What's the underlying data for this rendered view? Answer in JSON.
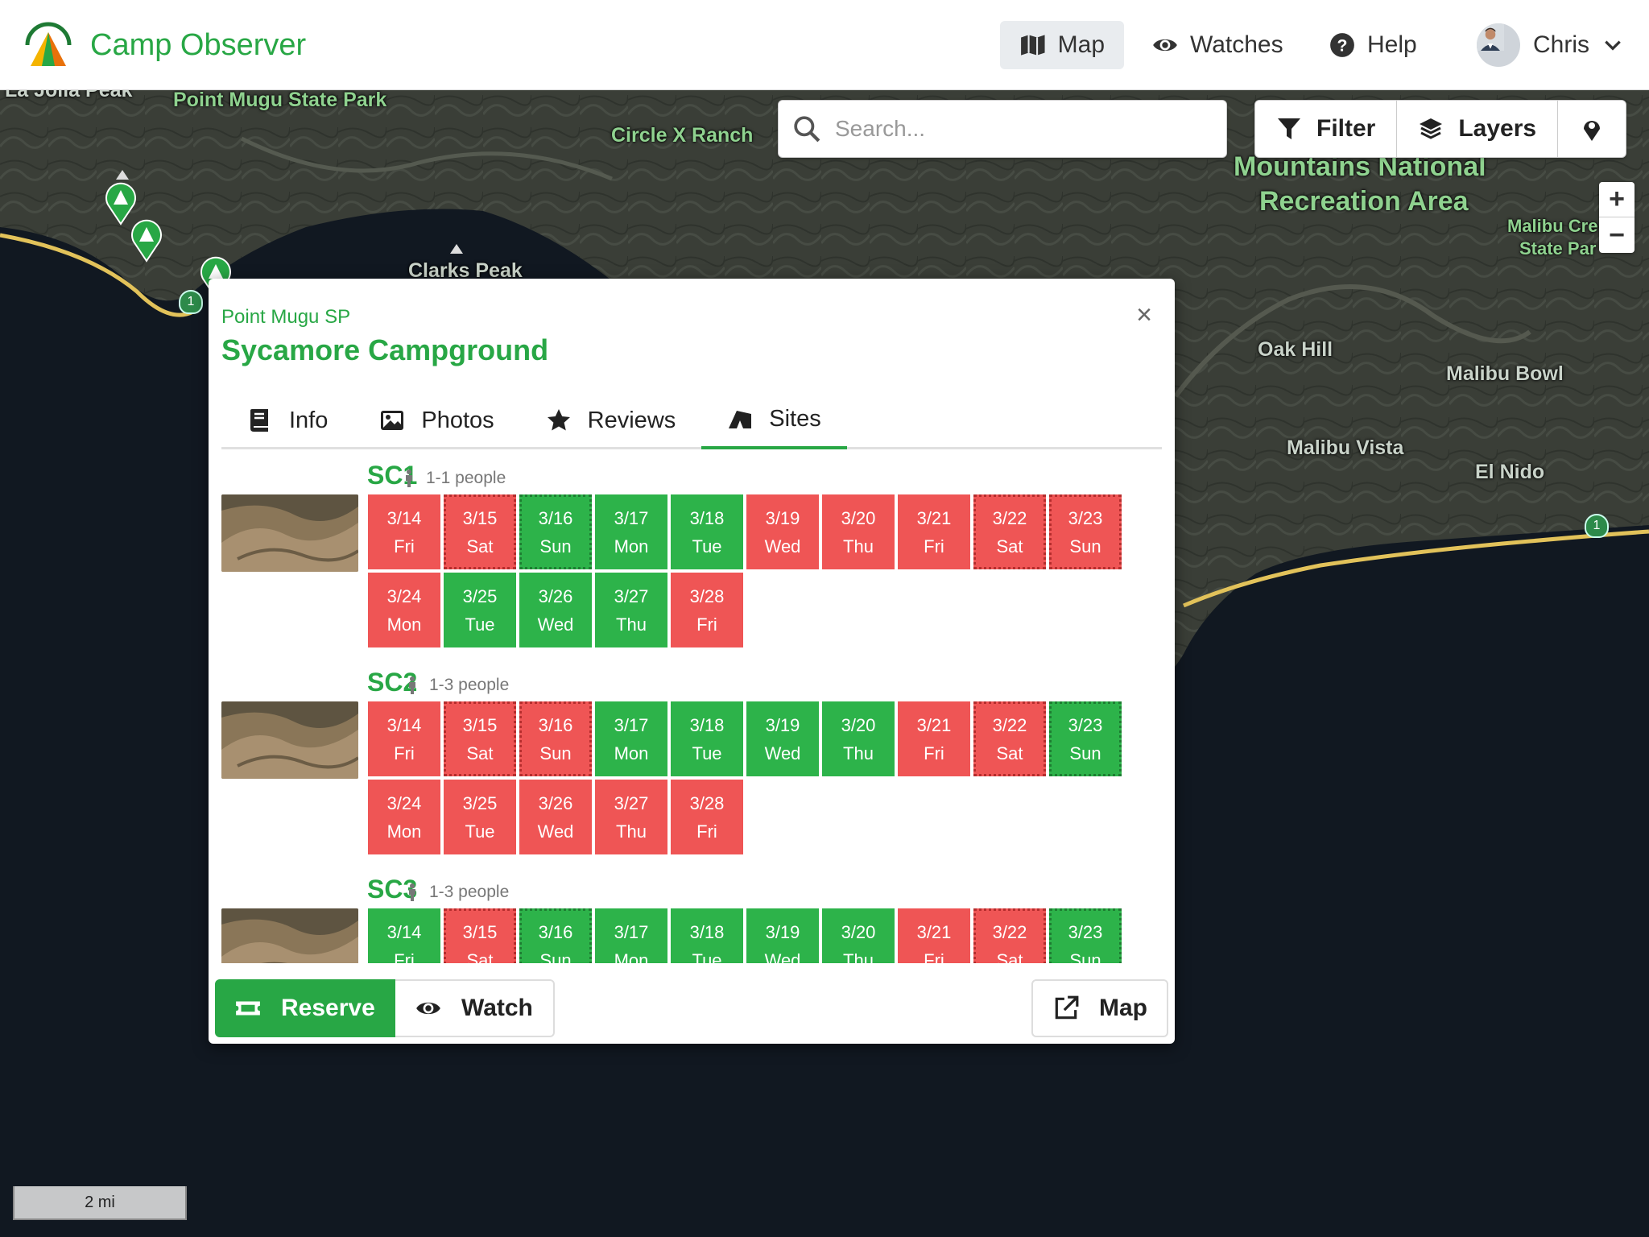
{
  "navbar": {
    "brand": "Camp Observer",
    "items": [
      {
        "label": "Map",
        "icon": "map-icon",
        "active": true
      },
      {
        "label": "Watches",
        "icon": "eye-icon"
      },
      {
        "label": "Help",
        "icon": "question-circle-icon"
      }
    ],
    "user": {
      "name": "Chris"
    }
  },
  "map": {
    "search_placeholder": "Search...",
    "tools": [
      {
        "label": "Filter",
        "icon": "filter-icon"
      },
      {
        "label": "Layers",
        "icon": "layers-icon"
      },
      {
        "label": "",
        "icon": "location-pin-icon"
      }
    ],
    "zoom_in": "+",
    "zoom_out": "−",
    "scale": "2 mi",
    "labels": {
      "la_jolla": "La Jolla Peak",
      "point_mugu": "Point Mugu State Park",
      "circle_x": "Circle X Ranch",
      "smnra_1": "Mountains National",
      "smnra_2": "Recreation Area",
      "malibu_creek_1": "Malibu Cre",
      "malibu_creek_2": "State Par",
      "clarks_peak": "Clarks Peak",
      "oak_hill": "Oak Hill",
      "malibu_bowl": "Malibu Bowl",
      "malibu_vista": "Malibu Vista",
      "el_nido": "El Nido",
      "route": "1"
    }
  },
  "popup": {
    "park": "Point Mugu SP",
    "title": "Sycamore Campground",
    "close": "×",
    "tabs": [
      {
        "label": "Info",
        "icon": "book-icon"
      },
      {
        "label": "Photos",
        "icon": "image-icon"
      },
      {
        "label": "Reviews",
        "icon": "star-icon"
      },
      {
        "label": "Sites",
        "icon": "campground-icon",
        "active": true
      }
    ],
    "sites": [
      {
        "name": "SC1",
        "people": "1-1 people",
        "days": [
          {
            "date": "3/14",
            "dow": "Fri",
            "status": "closed",
            "weekend": false
          },
          {
            "date": "3/15",
            "dow": "Sat",
            "status": "closed",
            "weekend": true
          },
          {
            "date": "3/16",
            "dow": "Sun",
            "status": "open",
            "weekend": true
          },
          {
            "date": "3/17",
            "dow": "Mon",
            "status": "open",
            "weekend": false
          },
          {
            "date": "3/18",
            "dow": "Tue",
            "status": "open",
            "weekend": false
          },
          {
            "date": "3/19",
            "dow": "Wed",
            "status": "closed",
            "weekend": false
          },
          {
            "date": "3/20",
            "dow": "Thu",
            "status": "closed",
            "weekend": false
          },
          {
            "date": "3/21",
            "dow": "Fri",
            "status": "closed",
            "weekend": false
          },
          {
            "date": "3/22",
            "dow": "Sat",
            "status": "closed",
            "weekend": true
          },
          {
            "date": "3/23",
            "dow": "Sun",
            "status": "closed",
            "weekend": true
          },
          {
            "date": "3/24",
            "dow": "Mon",
            "status": "closed",
            "weekend": false
          },
          {
            "date": "3/25",
            "dow": "Tue",
            "status": "open",
            "weekend": false
          },
          {
            "date": "3/26",
            "dow": "Wed",
            "status": "open",
            "weekend": false
          },
          {
            "date": "3/27",
            "dow": "Thu",
            "status": "open",
            "weekend": false
          },
          {
            "date": "3/28",
            "dow": "Fri",
            "status": "closed",
            "weekend": false
          }
        ]
      },
      {
        "name": "SC2",
        "people": "1-3 people",
        "days": [
          {
            "date": "3/14",
            "dow": "Fri",
            "status": "closed",
            "weekend": false
          },
          {
            "date": "3/15",
            "dow": "Sat",
            "status": "closed",
            "weekend": true
          },
          {
            "date": "3/16",
            "dow": "Sun",
            "status": "closed",
            "weekend": true
          },
          {
            "date": "3/17",
            "dow": "Mon",
            "status": "open",
            "weekend": false
          },
          {
            "date": "3/18",
            "dow": "Tue",
            "status": "open",
            "weekend": false
          },
          {
            "date": "3/19",
            "dow": "Wed",
            "status": "open",
            "weekend": false
          },
          {
            "date": "3/20",
            "dow": "Thu",
            "status": "open",
            "weekend": false
          },
          {
            "date": "3/21",
            "dow": "Fri",
            "status": "closed",
            "weekend": false
          },
          {
            "date": "3/22",
            "dow": "Sat",
            "status": "closed",
            "weekend": true
          },
          {
            "date": "3/23",
            "dow": "Sun",
            "status": "open",
            "weekend": true
          },
          {
            "date": "3/24",
            "dow": "Mon",
            "status": "closed",
            "weekend": false
          },
          {
            "date": "3/25",
            "dow": "Tue",
            "status": "closed",
            "weekend": false
          },
          {
            "date": "3/26",
            "dow": "Wed",
            "status": "closed",
            "weekend": false
          },
          {
            "date": "3/27",
            "dow": "Thu",
            "status": "closed",
            "weekend": false
          },
          {
            "date": "3/28",
            "dow": "Fri",
            "status": "closed",
            "weekend": false
          }
        ]
      },
      {
        "name": "SC3",
        "people": "1-3 people",
        "days": [
          {
            "date": "3/14",
            "dow": "Fri",
            "status": "open",
            "weekend": false
          },
          {
            "date": "3/15",
            "dow": "Sat",
            "status": "closed",
            "weekend": true
          },
          {
            "date": "3/16",
            "dow": "Sun",
            "status": "open",
            "weekend": true
          },
          {
            "date": "3/17",
            "dow": "Mon",
            "status": "open",
            "weekend": false
          },
          {
            "date": "3/18",
            "dow": "Tue",
            "status": "open",
            "weekend": false
          },
          {
            "date": "3/19",
            "dow": "Wed",
            "status": "open",
            "weekend": false
          },
          {
            "date": "3/20",
            "dow": "Thu",
            "status": "open",
            "weekend": false
          },
          {
            "date": "3/21",
            "dow": "Fri",
            "status": "closed",
            "weekend": false
          },
          {
            "date": "3/22",
            "dow": "Sat",
            "status": "closed",
            "weekend": true
          },
          {
            "date": "3/23",
            "dow": "Sun",
            "status": "open",
            "weekend": true
          }
        ]
      }
    ],
    "buttons": {
      "reserve": "Reserve",
      "watch": "Watch",
      "map": "Map"
    }
  },
  "colors": {
    "brand": "#28a745",
    "available": "#2db34a",
    "unavailable": "#ef5555"
  }
}
